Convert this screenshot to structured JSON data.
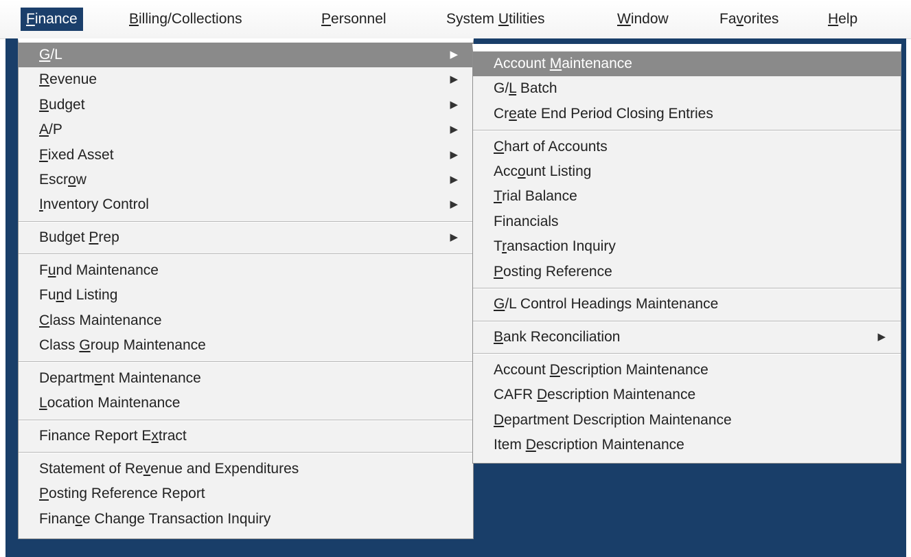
{
  "menubar": [
    {
      "label": "Finance",
      "mnemonic": 0,
      "active": true
    },
    {
      "label": "Billing/Collections",
      "mnemonic": 0
    },
    {
      "label": "Personnel",
      "mnemonic": 0
    },
    {
      "label": "System Utilities",
      "mnemonic": 7
    },
    {
      "label": "Window",
      "mnemonic": 0
    },
    {
      "label": "Favorites",
      "mnemonic": 2
    },
    {
      "label": "Help",
      "mnemonic": 0
    }
  ],
  "finance_menu": {
    "groups": [
      [
        {
          "label": "G/L",
          "mnemonic": 0,
          "submenu": true,
          "highlighted": true
        },
        {
          "label": "Revenue",
          "mnemonic": 0,
          "submenu": true
        },
        {
          "label": "Budget",
          "mnemonic": 0,
          "submenu": true
        },
        {
          "label": "A/P",
          "mnemonic": 0,
          "submenu": true
        },
        {
          "label": "Fixed Asset",
          "mnemonic": 0,
          "submenu": true
        },
        {
          "label": "Escrow",
          "mnemonic": 4,
          "submenu": true
        },
        {
          "label": "Inventory Control",
          "mnemonic": 0,
          "submenu": true
        }
      ],
      [
        {
          "label": "Budget Prep",
          "mnemonic": 7,
          "submenu": true
        }
      ],
      [
        {
          "label": "Fund Maintenance",
          "mnemonic": 1
        },
        {
          "label": "Fund Listing",
          "mnemonic": 2
        },
        {
          "label": "Class Maintenance",
          "mnemonic": 0
        },
        {
          "label": "Class Group Maintenance",
          "mnemonic": 6
        }
      ],
      [
        {
          "label": "Department Maintenance",
          "mnemonic": 7
        },
        {
          "label": "Location Maintenance",
          "mnemonic": 0
        }
      ],
      [
        {
          "label": "Finance Report Extract",
          "mnemonic": 16
        }
      ],
      [
        {
          "label": "Statement of Revenue and Expenditures",
          "mnemonic": 15
        },
        {
          "label": "Posting Reference Report",
          "mnemonic": 0
        },
        {
          "label": "Finance Change Transaction Inquiry",
          "mnemonic": 5
        }
      ]
    ]
  },
  "gl_submenu": {
    "groups": [
      [
        {
          "label": "Account Maintenance",
          "mnemonic": 8,
          "highlighted": true
        },
        {
          "label": "G/L Batch",
          "mnemonic": 2
        },
        {
          "label": "Create End Period Closing Entries",
          "mnemonic": 2
        }
      ],
      [
        {
          "label": "Chart of Accounts",
          "mnemonic": 0
        },
        {
          "label": "Account Listing",
          "mnemonic": 3
        },
        {
          "label": "Trial Balance",
          "mnemonic": 0
        },
        {
          "label": "Financials",
          "mnemonic": -1
        },
        {
          "label": "Transaction Inquiry",
          "mnemonic": 1
        },
        {
          "label": "Posting Reference",
          "mnemonic": 0
        }
      ],
      [
        {
          "label": "G/L Control Headings Maintenance",
          "mnemonic": 0
        }
      ],
      [
        {
          "label": "Bank Reconciliation",
          "mnemonic": 0,
          "submenu": true
        }
      ],
      [
        {
          "label": "Account Description Maintenance",
          "mnemonic": 8
        },
        {
          "label": "CAFR Description Maintenance",
          "mnemonic": 5
        },
        {
          "label": "Department Description Maintenance",
          "mnemonic": 0
        },
        {
          "label": "Item Description Maintenance",
          "mnemonic": 5
        }
      ]
    ]
  },
  "icons": {
    "submenu_arrow": "▶"
  },
  "colors": {
    "desktop": "#193e69",
    "menu_bg": "#f2f2f2",
    "highlight": "#8a8a8a",
    "menubar_active": "#1b3f6b"
  }
}
